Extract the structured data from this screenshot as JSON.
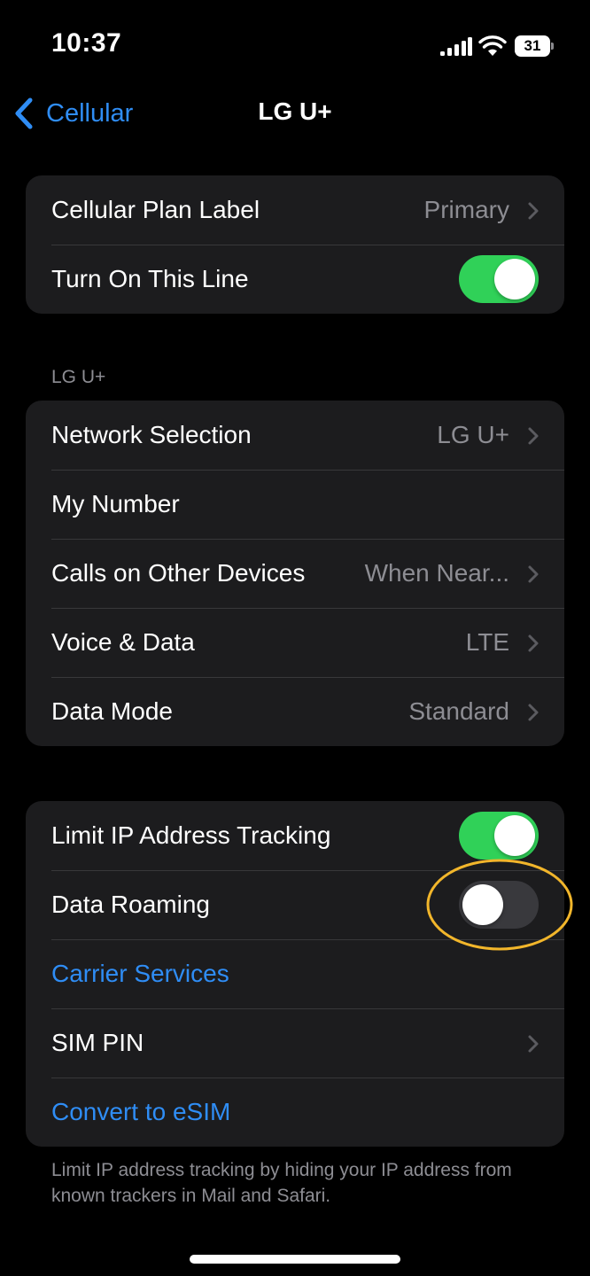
{
  "status_bar": {
    "time": "10:37",
    "battery_level": "31",
    "icons": [
      "signal-icon",
      "wifi-icon",
      "battery-icon"
    ]
  },
  "nav": {
    "back_label": "Cellular",
    "title": "LG U+"
  },
  "group1": {
    "plan_label": {
      "label": "Cellular Plan Label",
      "value": "Primary"
    },
    "turn_on_line": {
      "label": "Turn On This Line",
      "state": "on"
    }
  },
  "section_header": "LG U+",
  "group2": {
    "network_selection": {
      "label": "Network Selection",
      "value": "LG U+"
    },
    "my_number": {
      "label": "My Number",
      "value": ""
    },
    "calls_other_devices": {
      "label": "Calls on Other Devices",
      "value": "When Near..."
    },
    "voice_data": {
      "label": "Voice & Data",
      "value": "LTE"
    },
    "data_mode": {
      "label": "Data Mode",
      "value": "Standard"
    }
  },
  "group3": {
    "limit_ip_tracking": {
      "label": "Limit IP Address Tracking",
      "state": "on"
    },
    "data_roaming": {
      "label": "Data Roaming",
      "state": "off"
    },
    "carrier_services": {
      "label": "Carrier Services"
    },
    "sim_pin": {
      "label": "SIM PIN"
    },
    "convert_esim": {
      "label": "Convert to eSIM"
    }
  },
  "footer_note": "Limit IP address tracking by hiding your IP address from known trackers in Mail and Safari.",
  "colors": {
    "background": "#000000",
    "group_background": "#1c1c1e",
    "accent_blue": "#2f8df5",
    "toggle_on": "#30d158",
    "toggle_off": "#39393d",
    "secondary_text": "#8d8d93",
    "highlight_annotation": "#f2b62b"
  }
}
